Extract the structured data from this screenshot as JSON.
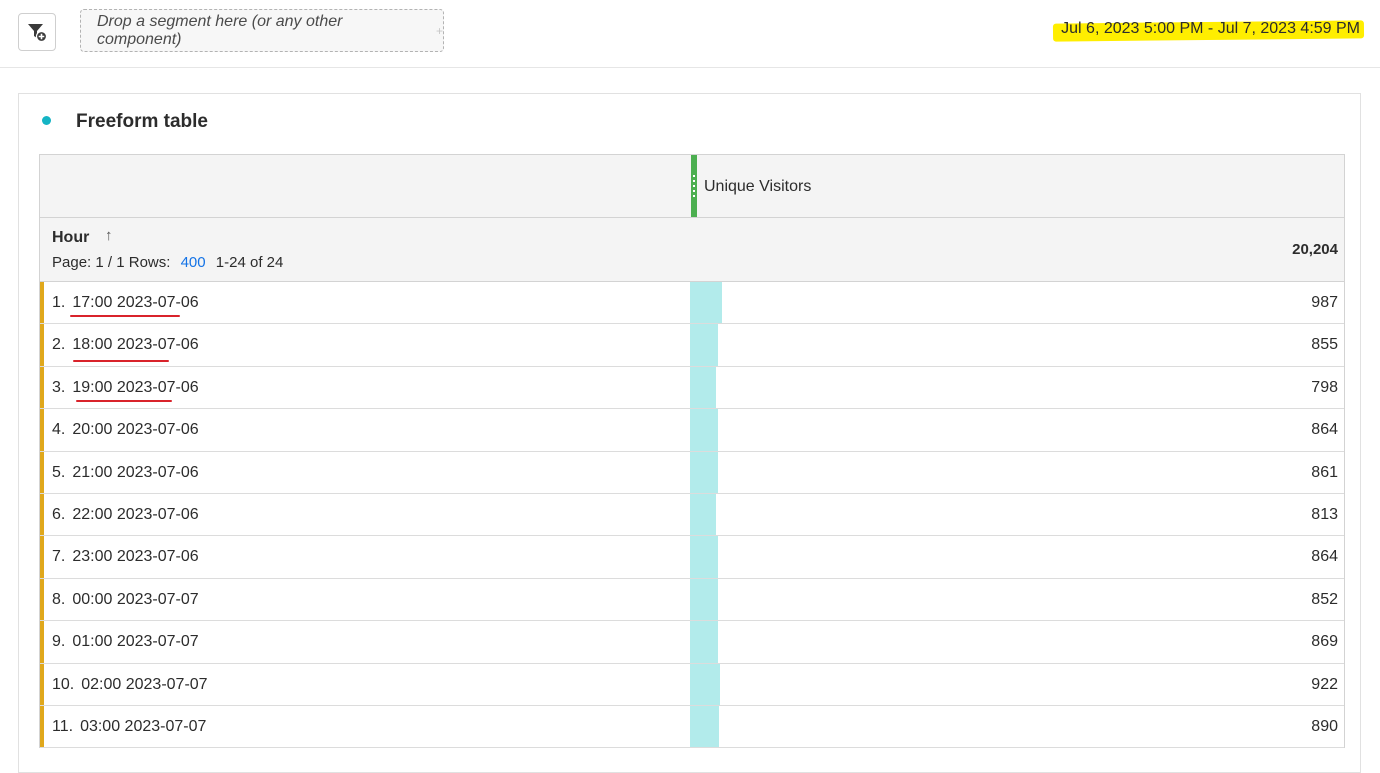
{
  "topbar": {
    "filter_icon": "filter-add-icon",
    "dropzone_text": "Drop a segment here (or any other component)",
    "date_range": "Jul 6, 2023 5:00 PM - Jul 7, 2023 4:59 PM",
    "highlight_color": "#ffee00"
  },
  "panel": {
    "title": "Freeform table",
    "dot_color": "#14b4c4"
  },
  "table": {
    "metric_header": "Unique Visitors",
    "dimension_header": "Hour",
    "sort_icon": "arrow-up-icon",
    "page_label": "Page: 1 / 1",
    "rows_label": "Rows:",
    "rows_value": "400",
    "range_label": "1-24 of 24",
    "total": "20,204",
    "accent_color": "#e0a81c",
    "bar_color": "#b2ebeb",
    "rows": [
      {
        "index": "1.",
        "label": "17:00 2023-07-06",
        "value": "987",
        "share": 1.0,
        "underlined": true
      },
      {
        "index": "2.",
        "label": "18:00 2023-07-06",
        "value": "855",
        "share": 0.866,
        "underlined": true
      },
      {
        "index": "3.",
        "label": "19:00 2023-07-06",
        "value": "798",
        "share": 0.809,
        "underlined": true
      },
      {
        "index": "4.",
        "label": "20:00 2023-07-06",
        "value": "864",
        "share": 0.875,
        "underlined": false
      },
      {
        "index": "5.",
        "label": "21:00 2023-07-06",
        "value": "861",
        "share": 0.872,
        "underlined": false
      },
      {
        "index": "6.",
        "label": "22:00 2023-07-06",
        "value": "813",
        "share": 0.824,
        "underlined": false
      },
      {
        "index": "7.",
        "label": "23:00 2023-07-06",
        "value": "864",
        "share": 0.875,
        "underlined": false
      },
      {
        "index": "8.",
        "label": "00:00 2023-07-07",
        "value": "852",
        "share": 0.863,
        "underlined": false
      },
      {
        "index": "9.",
        "label": "01:00 2023-07-07",
        "value": "869",
        "share": 0.88,
        "underlined": false
      },
      {
        "index": "10.",
        "label": "02:00 2023-07-07",
        "value": "922",
        "share": 0.934,
        "underlined": false
      },
      {
        "index": "11.",
        "label": "03:00 2023-07-07",
        "value": "890",
        "share": 0.902,
        "underlined": false
      }
    ]
  }
}
